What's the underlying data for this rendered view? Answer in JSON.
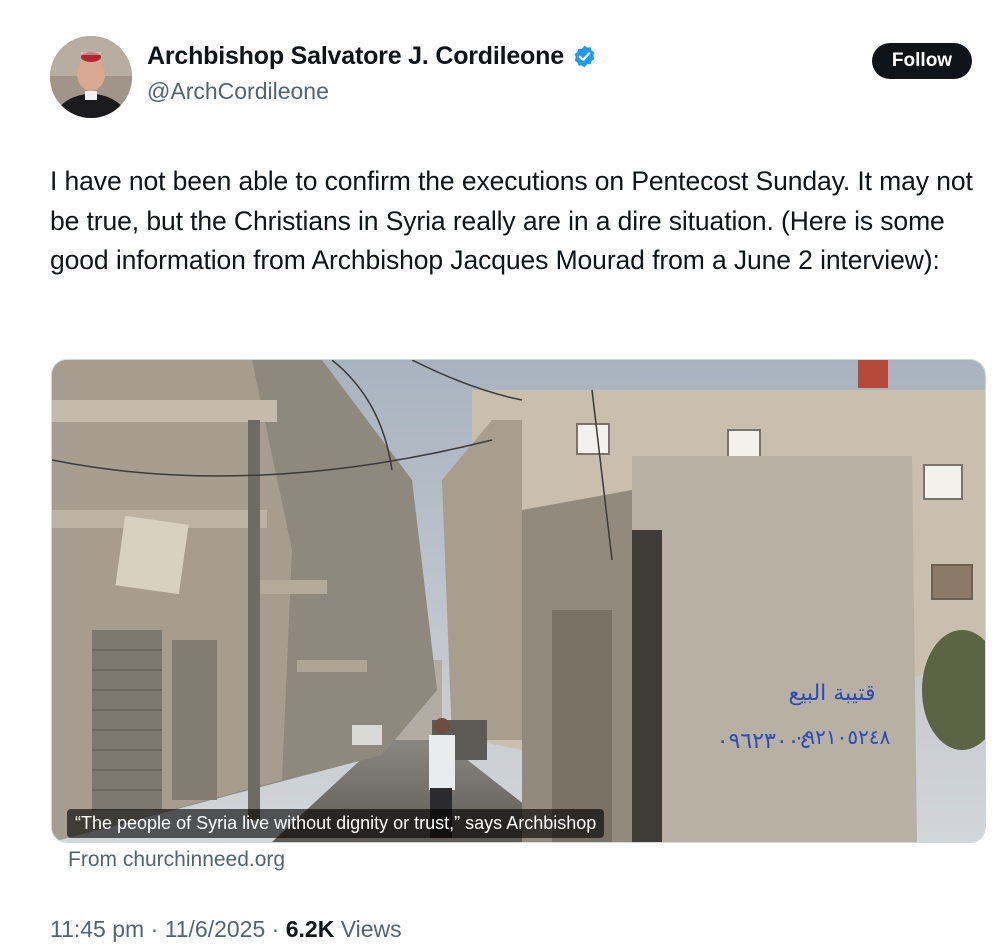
{
  "author": {
    "name": "Archbishop Salvatore J. Cordileone",
    "handle": "@ArchCordileone",
    "verified": true,
    "verified_color": "#1d9bf0"
  },
  "follow_label": "Follow",
  "tweet_text": "I have not been able to confirm the executions on Pentecost Sunday. It may not be true, but the Christians in Syria really are in a dire situation. (Here is some good information from Archbishop Jacques Mourad from a June 2 interview):",
  "media": {
    "caption": "“The people of Syria live without dignity or trust,” says Archbishop",
    "source": "From churchinneed.org",
    "graffiti_line1": "قتيبة البيع",
    "graffiti_line2": "٠٩٦٢٣٠٠٤",
    "graffiti_line3": "٠٩٢١٠٥٢٤٨"
  },
  "meta": {
    "time": "11:45 pm",
    "date": "11/6/2025",
    "views_count": "6.2K",
    "views_label": "Views",
    "separator": "·"
  }
}
